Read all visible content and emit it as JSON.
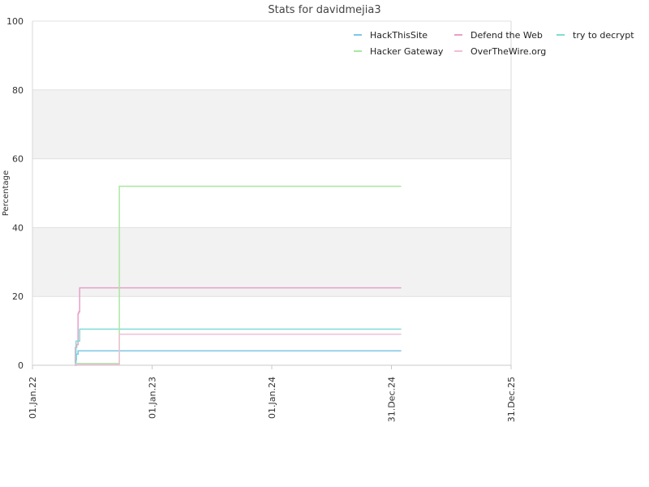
{
  "chart_data": {
    "type": "line",
    "title": "Stats for davidmejia3",
    "xlabel": "",
    "ylabel": "Percentage",
    "ylim": [
      0,
      100
    ],
    "xlim": [
      "2022-01-01",
      "2025-12-31"
    ],
    "yticks": [
      0,
      20,
      40,
      60,
      80,
      100
    ],
    "xticks": [
      {
        "date": "2022-01-01",
        "label": "01.Jan.22"
      },
      {
        "date": "2023-01-01",
        "label": "01.Jan.23"
      },
      {
        "date": "2024-01-01",
        "label": "01.Jan.24"
      },
      {
        "date": "2024-12-31",
        "label": "31.Dec.24"
      },
      {
        "date": "2025-12-31",
        "label": "31.Dec.25"
      }
    ],
    "grid": true,
    "alternating_bands": true,
    "legend_position": "top-right",
    "series": [
      {
        "name": "HackThisSite",
        "color": "#7fc6e8",
        "points": [
          [
            "2022-05-10",
            0
          ],
          [
            "2022-05-12",
            1.5
          ],
          [
            "2022-05-15",
            3.2
          ],
          [
            "2022-05-20",
            4.2
          ],
          [
            "2025-01-30",
            4.2
          ]
        ]
      },
      {
        "name": "Defend the Web",
        "color": "#e8a0c8",
        "points": [
          [
            "2022-05-10",
            0
          ],
          [
            "2022-05-12",
            5.2
          ],
          [
            "2022-05-16",
            6.0
          ],
          [
            "2022-05-20",
            15.0
          ],
          [
            "2022-05-22",
            15.5
          ],
          [
            "2022-05-25",
            22.5
          ],
          [
            "2025-01-30",
            22.5
          ]
        ]
      },
      {
        "name": "try to decrypt",
        "color": "#80dcd4",
        "points": [
          [
            "2022-05-10",
            0
          ],
          [
            "2022-05-14",
            7.0
          ],
          [
            "2022-05-25",
            10.5
          ],
          [
            "2025-01-30",
            10.5
          ]
        ]
      },
      {
        "name": "Hacker Gateway",
        "color": "#a8e8a0",
        "points": [
          [
            "2022-05-10",
            0.5
          ],
          [
            "2022-09-20",
            0.5
          ],
          [
            "2022-09-23",
            52.0
          ],
          [
            "2025-01-30",
            52.0
          ]
        ]
      },
      {
        "name": "OverTheWire.org",
        "color": "#f0c0d4",
        "points": [
          [
            "2022-05-10",
            0
          ],
          [
            "2022-05-12",
            0.3
          ],
          [
            "2022-09-20",
            0.3
          ],
          [
            "2022-09-23",
            9.0
          ],
          [
            "2025-01-30",
            9.0
          ]
        ]
      }
    ]
  }
}
